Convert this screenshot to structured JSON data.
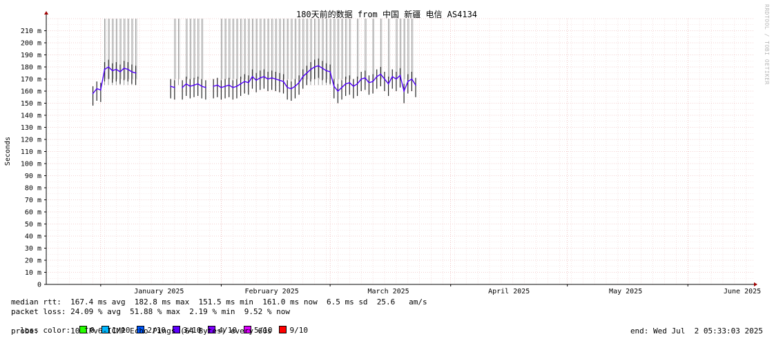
{
  "chart_data": {
    "type": "line",
    "title": "180天前的数据 from 中国 新疆 电信 AS4134",
    "ylabel": "Seconds",
    "ylim": [
      0,
      220
    ],
    "y_unit": "m",
    "y_tick_labels": [
      "0",
      "10 m",
      "20 m",
      "30 m",
      "40 m",
      "50 m",
      "60 m",
      "70 m",
      "80 m",
      "90 m",
      "100 m",
      "110 m",
      "120 m",
      "130 m",
      "140 m",
      "150 m",
      "160 m",
      "170 m",
      "180 m",
      "190 m",
      "200 m",
      "210 m"
    ],
    "x_tick_labels": [
      "January 2025",
      "February 2025",
      "March 2025",
      "April 2025",
      "May 2025",
      "June 2025"
    ],
    "xlim": [
      "2024-12-18",
      "2025-06-18"
    ],
    "grid": true,
    "series": [
      {
        "color": "#5000f8",
        "x": [
          "2024-12-30",
          "2024-12-31",
          "2025-01-01",
          "2025-01-02",
          "2025-01-03",
          "2025-01-04",
          "2025-01-05",
          "2025-01-06",
          "2025-01-07",
          "2025-01-08",
          "2025-01-09",
          "2025-01-10",
          "2025-01-19",
          "2025-01-20",
          "2025-01-22",
          "2025-01-23",
          "2025-01-24",
          "2025-01-25",
          "2025-01-26",
          "2025-01-27",
          "2025-01-28",
          "2025-01-30",
          "2025-01-31",
          "2025-02-01",
          "2025-02-02",
          "2025-02-03",
          "2025-02-04",
          "2025-02-05",
          "2025-02-06",
          "2025-02-07",
          "2025-02-08",
          "2025-02-09",
          "2025-02-10",
          "2025-02-11",
          "2025-02-12",
          "2025-02-13",
          "2025-02-14",
          "2025-02-15",
          "2025-02-16",
          "2025-02-17",
          "2025-02-18",
          "2025-02-19",
          "2025-02-20",
          "2025-02-21",
          "2025-02-22",
          "2025-02-23",
          "2025-02-24",
          "2025-02-25",
          "2025-02-26",
          "2025-02-27",
          "2025-02-28",
          "2025-03-01",
          "2025-03-02",
          "2025-03-03",
          "2025-03-04",
          "2025-03-05",
          "2025-03-06",
          "2025-03-07",
          "2025-03-08",
          "2025-03-09",
          "2025-03-10",
          "2025-03-11",
          "2025-03-12",
          "2025-03-13",
          "2025-03-14",
          "2025-03-15",
          "2025-03-16",
          "2025-03-17",
          "2025-03-18",
          "2025-03-19",
          "2025-03-20",
          "2025-03-21",
          "2025-03-22",
          "2025-03-23"
        ],
        "y": [
          158,
          162,
          161,
          178,
          180,
          177,
          178,
          176,
          179,
          178,
          176,
          175,
          164,
          163,
          163,
          166,
          164,
          165,
          166,
          164,
          163,
          164,
          165,
          163,
          164,
          165,
          163,
          164,
          166,
          168,
          167,
          172,
          169,
          171,
          172,
          170,
          171,
          170,
          169,
          168,
          163,
          162,
          164,
          167,
          172,
          175,
          178,
          180,
          181,
          179,
          177,
          176,
          164,
          160,
          163,
          166,
          167,
          164,
          166,
          170,
          171,
          167,
          168,
          172,
          174,
          170,
          166,
          172,
          170,
          173,
          160,
          168,
          170,
          165
        ],
        "gaps_after": [
          "2025-01-10",
          "2025-01-20",
          "2025-01-28"
        ]
      }
    ],
    "loss_spikes_x": [
      "2025-01-02",
      "2025-01-03",
      "2025-01-04",
      "2025-01-05",
      "2025-01-06",
      "2025-01-07",
      "2025-01-08",
      "2025-01-09",
      "2025-01-10",
      "2025-01-20",
      "2025-01-21",
      "2025-01-23",
      "2025-01-24",
      "2025-01-25",
      "2025-01-26",
      "2025-01-27",
      "2025-02-01",
      "2025-02-02",
      "2025-02-03",
      "2025-02-04",
      "2025-02-05",
      "2025-02-06",
      "2025-02-07",
      "2025-02-08",
      "2025-02-09",
      "2025-02-10",
      "2025-02-11",
      "2025-02-12",
      "2025-02-13",
      "2025-02-14",
      "2025-02-15",
      "2025-02-16",
      "2025-02-17",
      "2025-02-18",
      "2025-02-19",
      "2025-02-20",
      "2025-02-21",
      "2025-02-22",
      "2025-02-23",
      "2025-02-24",
      "2025-02-25",
      "2025-02-26",
      "2025-02-27",
      "2025-02-28",
      "2025-03-01",
      "2025-03-02",
      "2025-03-03",
      "2025-03-04",
      "2025-03-05",
      "2025-03-06",
      "2025-03-08",
      "2025-03-10",
      "2025-03-12",
      "2025-03-14",
      "2025-03-16",
      "2025-03-18",
      "2025-03-19",
      "2025-03-20",
      "2025-03-21",
      "2025-03-22"
    ]
  },
  "stats": {
    "median_rtt": "median rtt:  167.4 ms avg  182.8 ms max  151.5 ms min  161.0 ms now  6.5 ms sd  25.6   am/s",
    "packet_loss": "packet loss: 24.09 % avg  51.88 % max  2.19 % min  9.52 % now",
    "loss_color_label": "loss color:",
    "loss_colors": [
      {
        "label": "0",
        "color": "#26ff00"
      },
      {
        "label": "1/10",
        "color": "#00b8ff"
      },
      {
        "label": "2/10",
        "color": "#0059ff"
      },
      {
        "label": "3/10",
        "color": "#5e00ff"
      },
      {
        "label": "4/10",
        "color": "#7e00ff"
      },
      {
        "label": "5/10",
        "color": "#dd00ff"
      },
      {
        "label": "9/10",
        "color": "#ff0000"
      }
    ],
    "probe": "probe:       10 IPv6-ICMP Echo Pings (64 Bytes) every 60s",
    "end": "end: Wed Jul  2 05:33:03 2025"
  },
  "watermark": "RRDTOOL / TOBI OETIKER"
}
